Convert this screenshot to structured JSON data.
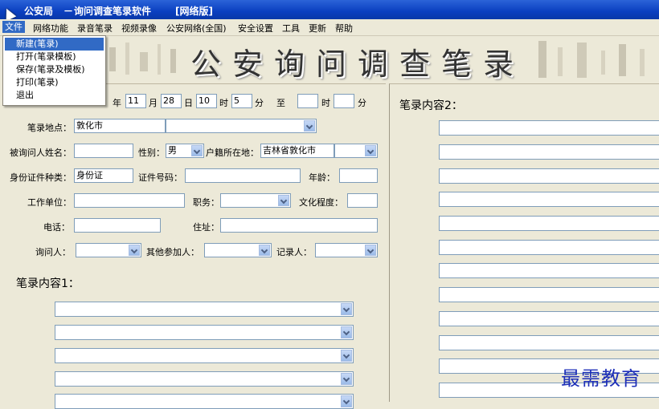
{
  "window": {
    "title_app": "公安局",
    "title_sep": "－",
    "title_name": "询问调查笔录软件",
    "title_edition": "[网络版]"
  },
  "menu": [
    "文件",
    "网络功能",
    "录音笔录",
    "视频录像",
    "公安网络(全国)",
    "安全设置",
    "工具",
    "更新",
    "帮助"
  ],
  "file_menu": [
    "新建(笔录)",
    "打开(笔录模板)",
    "保存(笔录及模板)",
    "打印(笔录)",
    "退出"
  ],
  "banner": {
    "title": "公安询问调查笔录"
  },
  "time": {
    "year_label": "年",
    "month": "11",
    "month_label": "月",
    "day": "28",
    "day_label": "日",
    "hour": "10",
    "hour_label": "时",
    "minute": "5",
    "minute_label": "分",
    "to_label": "至",
    "end_hour": "",
    "end_hour_label": "时",
    "end_minute": "",
    "end_minute_label": "分"
  },
  "form": {
    "location_label": "笔录地点：",
    "location_value": "敦化市",
    "location_combo": "",
    "name_label": "被询问人姓名：",
    "name_value": "",
    "gender_label": "性别：",
    "gender_value": "男",
    "hukou_label": "户籍所在地：",
    "hukou_value": "吉林省敦化市",
    "hukou_combo": "",
    "idtype_label": "身份证件种类：",
    "idtype_value": "身份证",
    "idno_label": "证件号码：",
    "idno_value": "",
    "age_label": "年龄：",
    "age_value": "",
    "work_label": "工作单位：",
    "work_value": "",
    "job_label": "职务：",
    "job_value": "",
    "edu_label": "文化程度：",
    "edu_value": "",
    "phone_label": "电话：",
    "phone_value": "",
    "addr_label": "住址：",
    "addr_value": "",
    "interviewer_label": "询问人：",
    "interviewer_value": "",
    "others_label": "其他参加人：",
    "others_value": "",
    "recorder_label": "记录人：",
    "recorder_value": ""
  },
  "content1": {
    "title": "笔录内容1："
  },
  "content2": {
    "title": "笔录内容2："
  },
  "watermark": "最需教育",
  "colors": {
    "titlebar": "#0a3fc0",
    "menu_highlight": "#316ac5",
    "window_bg": "#ece9d8",
    "watermark": "#1d2fb8"
  }
}
